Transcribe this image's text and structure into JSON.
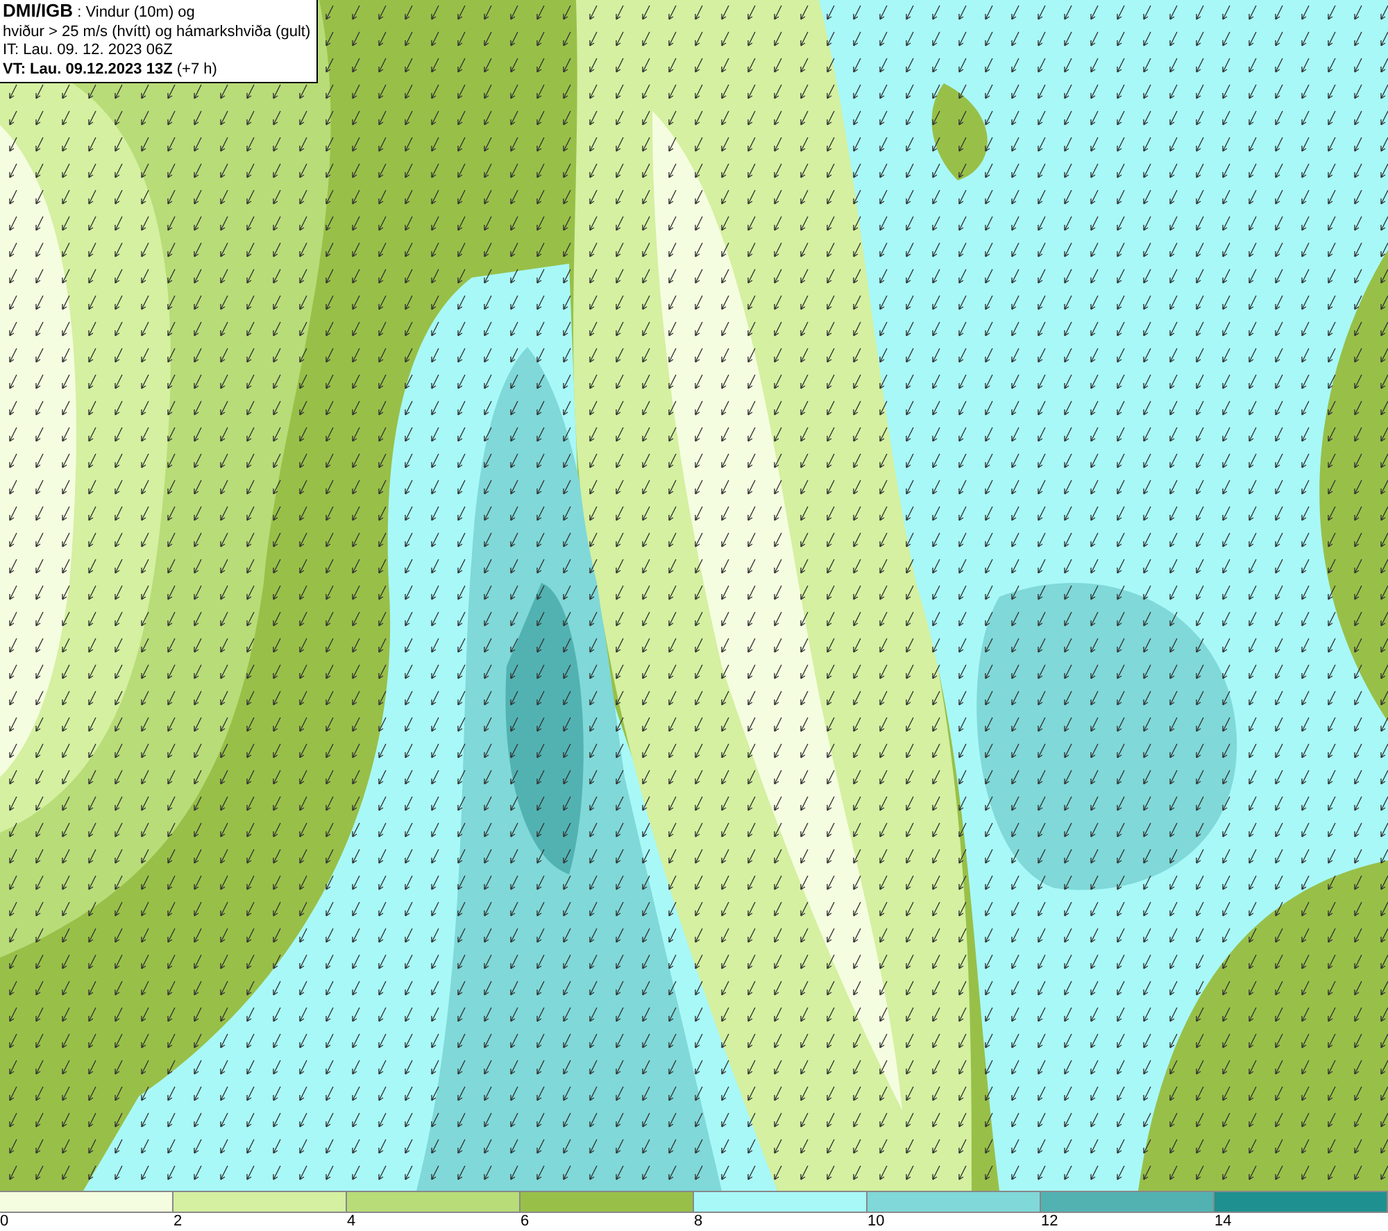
{
  "header": {
    "lines": [
      "**DMI/IGB** : Vindur (10m) og",
      "hviður > 25 m/s (hvítt) og hámarkshviða (gult)",
      "IT: Lau. 09. 12. 2023 06Z",
      "**VT: Lau. 09.12.2023 13Z** (+7 h)"
    ]
  },
  "legend": {
    "items": [
      {
        "label": "0",
        "color": "#f5fde0"
      },
      {
        "label": "2",
        "color": "#d4f0a0"
      },
      {
        "label": "4",
        "color": "#b8dc78"
      },
      {
        "label": "6",
        "color": "#98c048"
      },
      {
        "label": "8",
        "color": "#a8f8f8"
      },
      {
        "label": "10",
        "color": "#80d8d8"
      },
      {
        "label": "12",
        "color": "#52b2b2"
      },
      {
        "label": "14",
        "color": "#1f9090"
      }
    ]
  }
}
